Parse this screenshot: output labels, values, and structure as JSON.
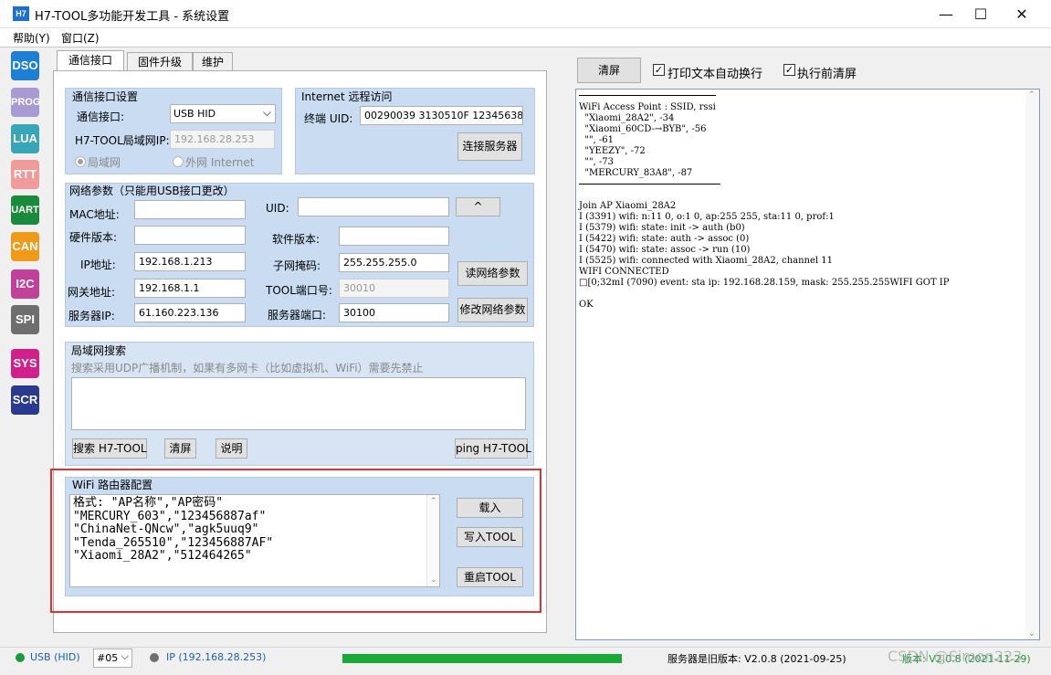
{
  "window": {
    "app_icon_text": "H7",
    "title": "H7-TOOL多功能开发工具 - 系统设置",
    "minimize": "—",
    "maximize": "☐",
    "close": "✕"
  },
  "menu": [
    "帮助(Y)",
    "窗口(Z)"
  ],
  "toolbar": {
    "buttons": [
      {
        "label": "DSO",
        "color": "#1e7fd6"
      },
      {
        "label": "PROG",
        "color": "#a89bd4"
      },
      {
        "label": "LUA",
        "color": "#37a6b8"
      },
      {
        "label": "RTT",
        "color": "#f29a9a"
      },
      {
        "label": "UART",
        "color": "#1a8a3c"
      },
      {
        "label": "CAN",
        "color": "#f09a1a"
      },
      {
        "label": "I2C",
        "color": "#c0409a"
      },
      {
        "label": "SPI",
        "color": "#6e6e6e"
      },
      {
        "label": "SYS",
        "color": "#d0208a"
      },
      {
        "label": "SCR",
        "color": "#2a3a8e"
      }
    ]
  },
  "tabs": [
    "通信接口",
    "固件升级",
    "维护"
  ],
  "comm": {
    "title": "通信接口设置",
    "interface_label": "通信接口:",
    "interface_value": "USB HID",
    "lan_ip_label": "H7-TOOL局域网IP:",
    "lan_ip_value": "192.168.28.253",
    "radio_lan": "局域网",
    "radio_internet": "外网 Internet"
  },
  "remote": {
    "title": "Internet 远程访问",
    "uid_label": "终端 UID:",
    "uid_value": "00290039 3130510F 12345638",
    "connect_button": "连接服务器"
  },
  "net": {
    "title": "网络参数（只能用USB接口更改）",
    "mac_label": "MAC地址:",
    "uid_label": "UID:",
    "up_button": "^",
    "hw_label": "硬件版本:",
    "sw_label": "软件版本:",
    "ip_label": "IP地址:",
    "ip_value": "192.168.1.213",
    "mask_label": "子网掩码:",
    "mask_value": "255.255.255.0",
    "read_button": "读网络参数",
    "gw_label": "网关地址:",
    "gw_value": "192.168.1.1",
    "port_label": "TOOL端口号:",
    "port_value": "30010",
    "server_ip_label": "服务器IP:",
    "server_ip_value": "61.160.223.136",
    "server_port_label": "服务器端口:",
    "server_port_value": "30100",
    "modify_button": "修改网络参数"
  },
  "lan_search": {
    "title": "局域网搜索",
    "hint": "搜索采用UDP广播机制，如果有多网卡（比如虚拟机、WiFi）需要先禁止",
    "search_button": "搜索 H7-TOOL",
    "clear_button": "清屏",
    "help_button": "说明",
    "ping_button": "ping H7-TOOL"
  },
  "wifi": {
    "title": "WiFi 路由器配置",
    "text": "格式: \"AP名称\",\"AP密码\"\n\"MERCURY_603\",\"123456887af\"\n\"ChinaNet-QNcw\",\"agk5uuq9\"\n\"Tenda_265510\",\"123456887AF\"\n\"Xiaomi_28A2\",\"512464265\"",
    "load_button": "载入",
    "write_button": "写入TOOL",
    "restart_button": "重启TOOL"
  },
  "right": {
    "clear_button": "清屏",
    "wrap_label": "打印文本自动换行",
    "clear_before_label": "执行前清屏",
    "output": "WiFi Access Point : SSID, rssi\n  \"Xiaomi_28A2\", -34\n  \"Xiaomi_60CD-→BYB\", -56\n  \"\", -61\n  \"YEEZY\", -72\n  \"\", -73\n  \"MERCURY_83A8\", -87\n\n\nJoin AP Xiaomi_28A2\nI (3391) wifi: n:11 0, o:1 0, ap:255 255, sta:11 0, prof:1\nI (5379) wifi: state: init -> auth (b0)\nI (5422) wifi: state: auth -> assoc (0)\nI (5470) wifi: state: assoc -> run (10)\nI (5525) wifi: connected with Xiaomi_28A2, channel 11\nWIFI CONNECTED\n□[0;32mI (7090) event: sta ip: 192.168.28.159, mask: 255.255.255WIFI GOT IP\n\nOK"
  },
  "status": {
    "usb": "USB (HID)",
    "port": "#05",
    "ip": "IP (192.168.28.253)",
    "progress": 1.0,
    "server": "服务器是旧版本: V2.0.8 (2021-09-25)",
    "version": "版本: V2.0.8 (2021-11-29)",
    "watermark": "CSDN @Simon223"
  },
  "colors": {
    "status_green": "#1a9a3a",
    "highlight_red": "#e03030",
    "group_blue": "#c9dcf1"
  }
}
